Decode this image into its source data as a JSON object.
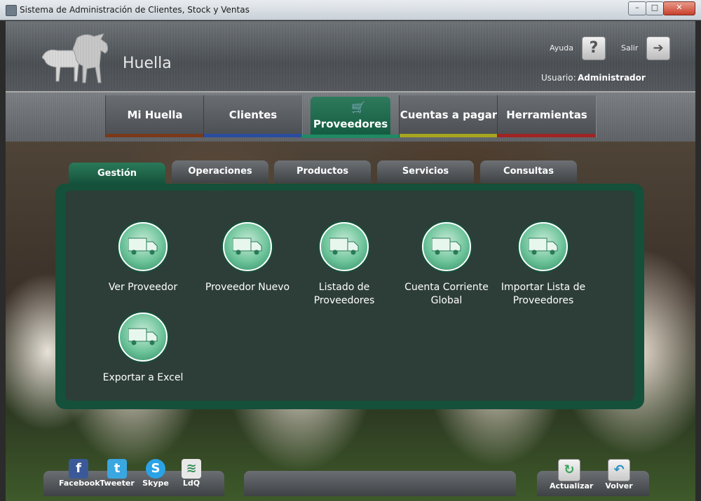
{
  "window": {
    "title": "Sistema de Administración de Clientes, Stock y Ventas",
    "min": "–",
    "max": "□",
    "close": "✕"
  },
  "header": {
    "brand": "Huella",
    "help_label": "Ayuda",
    "help_glyph": "?",
    "exit_label": "Salir",
    "exit_glyph": "➔",
    "user_label": "Usuario:",
    "user_value": "Administrador"
  },
  "nav": {
    "tabs": [
      {
        "label": "Mi Huella",
        "stripe": "#7a3a1a"
      },
      {
        "label": "Clientes",
        "stripe": "#2a4da0"
      },
      {
        "label": "Proveedores",
        "stripe": "#1f8a64",
        "active": true
      },
      {
        "label": "Cuentas a pagar",
        "stripe": "#a7a51f"
      },
      {
        "label": "Herramientas",
        "stripe": "#a02424"
      }
    ]
  },
  "subtabs": [
    "Gestión",
    "Operaciones",
    "Productos",
    "Servicios",
    "Consultas"
  ],
  "tiles": [
    "Ver Proveedor",
    "Proveedor Nuevo",
    "Listado de Proveedores",
    "Cuenta Corriente Global",
    "Importar Lista de Proveedores",
    "Exportar a Excel"
  ],
  "social": [
    {
      "label": "Facebook",
      "glyph": "f"
    },
    {
      "label": "Tweeter",
      "glyph": "t"
    },
    {
      "label": "Skype",
      "glyph": "S"
    },
    {
      "label": "LdQ",
      "glyph": "≋"
    }
  ],
  "actions": [
    {
      "label": "Actualizar",
      "glyph": "↻"
    },
    {
      "label": "Volver",
      "glyph": "↶"
    }
  ],
  "colors": {
    "accent": "#14503a",
    "tile_icon": "#6cc39a"
  }
}
